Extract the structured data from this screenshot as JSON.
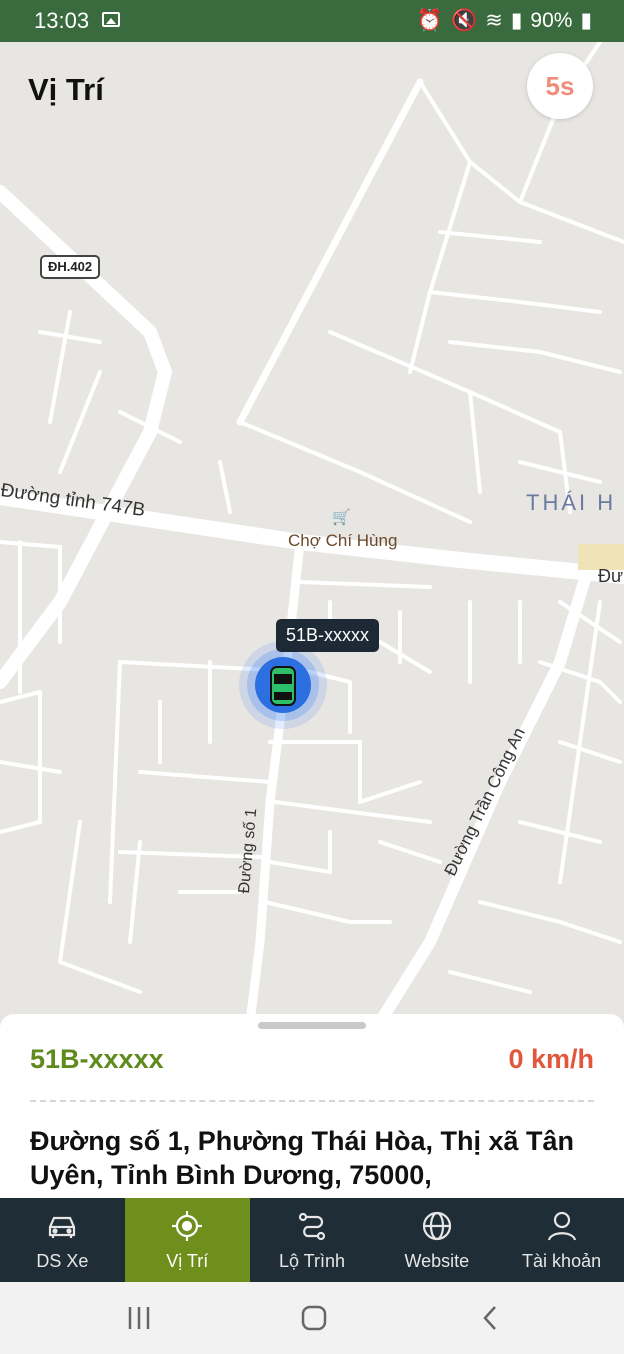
{
  "status_bar": {
    "time": "13:03",
    "battery": "90%"
  },
  "header": {
    "title": "Vị Trí",
    "refresh_label": "5s"
  },
  "map": {
    "road_badge": "ĐH.402",
    "labels": {
      "road_747b": "Đường tỉnh 747B",
      "cho_chi_hung": "Chợ Chí Hùng",
      "thai_hoa": "THÁI H",
      "road_right": "Đư",
      "duong_so_1": "Đường số 1",
      "tran_cong_an": "Đường Trần Công An"
    },
    "vehicle_tooltip": "51B-xxxxx"
  },
  "sheet": {
    "plate": "51B-xxxxx",
    "speed": "0 km/h",
    "address": "Đường số 1, Phường Thái Hòa, Thị xã Tân Uyên, Tỉnh Bình Dương, 75000,"
  },
  "bottom_nav": {
    "items": [
      {
        "label": "DS Xe",
        "icon": "car-icon"
      },
      {
        "label": "Vị Trí",
        "icon": "target-icon",
        "active": true
      },
      {
        "label": "Lộ Trình",
        "icon": "route-icon"
      },
      {
        "label": "Website",
        "icon": "globe-icon"
      },
      {
        "label": "Tài khoản",
        "icon": "user-icon"
      }
    ]
  },
  "colors": {
    "status_bar": "#3a6b3e",
    "accent_green": "#6f8f1c",
    "speed_red": "#e2573b",
    "nav_bg": "#1f2d36"
  }
}
